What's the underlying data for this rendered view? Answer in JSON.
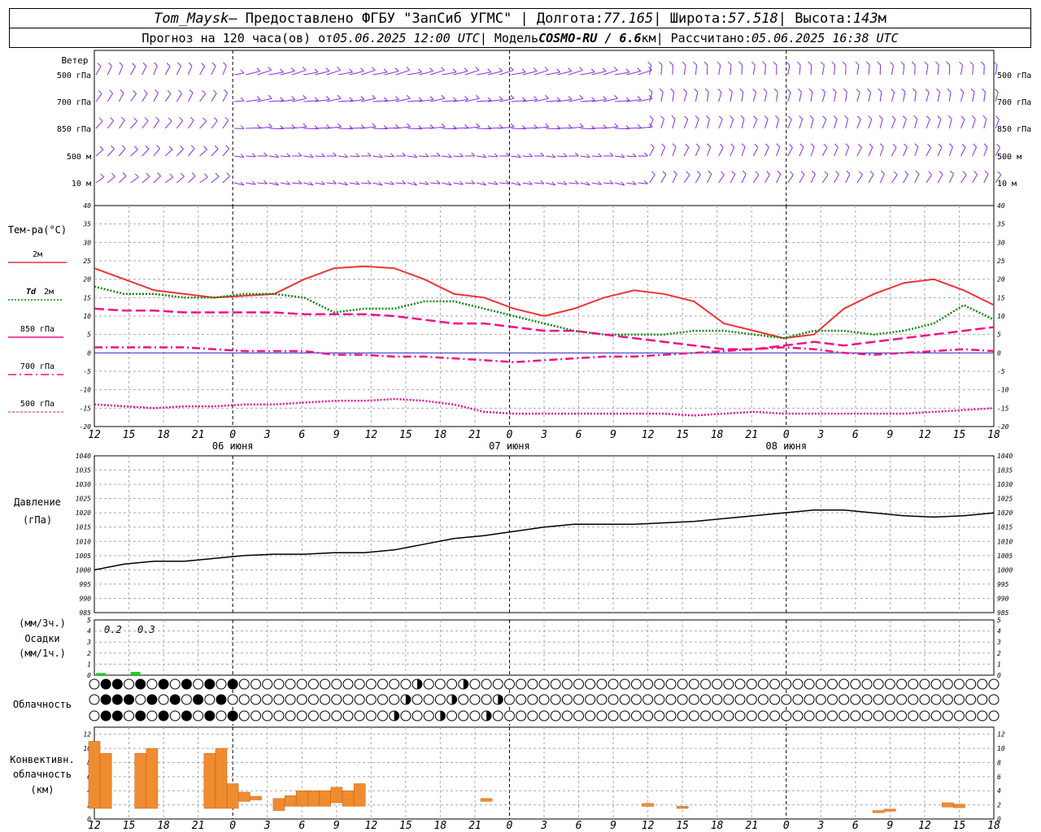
{
  "header": {
    "line1": {
      "station": "Tom_Maysk",
      "provider": " – Предоставлено ФГБУ \"ЗапСиб УГМС\" | Долгота: ",
      "lon": "77.165",
      "lat_label": " | Широта: ",
      "lat": "57.518",
      "alt_label": " | Высота: ",
      "alt": "143",
      "alt_unit": "м"
    },
    "line2": {
      "prefix": "Прогноз на 120 часа(ов) от ",
      "issued": "05.06.2025 12:00 UTC",
      "model_label": " | Модель ",
      "model": "COSMO-RU / 6.6",
      "model_unit": "км",
      "calc_label": " | Рассчитано: ",
      "calc": "05.06.2025 16:38 UTC"
    }
  },
  "colors": {
    "wind": "#8a2be2",
    "t2m": "#ee3333",
    "td2m": "#118811",
    "t850": "#ee1188",
    "t700": "#ee1188",
    "t500": "#ee1188",
    "pressure": "#000000",
    "precip": "#22cc22",
    "conv": "#f08c30",
    "zero_line": "#3333cc"
  },
  "wind_panel": {
    "title": "Ветер",
    "levels": [
      "500 гПа",
      "700 гПа",
      "850 гПа",
      "500 м",
      "10 м"
    ]
  },
  "temp_panel": {
    "title": "Тем-ра(°С)",
    "legend": [
      {
        "label": "2м",
        "style": "solid"
      },
      {
        "label_it": "Td",
        "label": "2м",
        "style": "dot"
      },
      {
        "label": "850 гПа",
        "style": "dash"
      },
      {
        "label": "700 гПа",
        "style": "dashdot"
      },
      {
        "label": "500 гПа",
        "style": "fine"
      }
    ]
  },
  "pressure_panel": {
    "title": "Давление",
    "unit": "(гПа)"
  },
  "precip_panel": {
    "label1": "(мм/3ч.)",
    "label2": "Осадки",
    "label3": "(мм/1ч.)",
    "values_text": [
      "0.2",
      "0.3"
    ]
  },
  "cloud_panel": {
    "title": "Облачность"
  },
  "conv_panel": {
    "label1": "Конвективн.",
    "label2": "облачность",
    "label3": "(км)"
  },
  "x_axis": {
    "hour_labels": [
      "12",
      "15",
      "18",
      "21",
      "0",
      "3",
      "6",
      "9",
      "12",
      "15",
      "18",
      "21",
      "0",
      "3",
      "6",
      "9",
      "12",
      "15",
      "18",
      "21",
      "0",
      "3",
      "6",
      "9",
      "12",
      "15",
      "18"
    ],
    "day_labels": [
      "06 июня",
      "07 июня",
      "08 июня"
    ]
  },
  "chart_data": [
    {
      "type": "line",
      "title": "Тем-ра(°С)",
      "x_hours": [
        0,
        3,
        6,
        9,
        12,
        15,
        18,
        21,
        24,
        27,
        30,
        33,
        36,
        39,
        42,
        45,
        48,
        51,
        54,
        57,
        60,
        63,
        66,
        69,
        72,
        75,
        78
      ],
      "ylim": [
        -20,
        40
      ],
      "series": [
        {
          "name": "2м",
          "values": [
            23,
            20,
            17,
            16,
            15,
            15.5,
            16,
            20,
            23,
            23.5,
            23,
            20,
            16,
            15,
            12,
            10,
            12,
            15,
            17,
            16,
            14,
            8,
            6,
            4,
            5,
            12,
            16,
            19,
            20,
            17,
            13
          ]
        },
        {
          "name": "Td 2м",
          "values": [
            18,
            16,
            16,
            15,
            15,
            16,
            16,
            15,
            11,
            12,
            12,
            14,
            14,
            12,
            10,
            8,
            6,
            5,
            5,
            5,
            6,
            6,
            5,
            4,
            6,
            6,
            5,
            6,
            8,
            13,
            9
          ]
        },
        {
          "name": "850 гПа",
          "values": [
            12,
            11.5,
            11.5,
            11,
            11,
            11,
            11,
            10.5,
            10.5,
            10.5,
            10,
            9,
            8,
            8,
            7,
            6,
            6,
            5,
            4,
            3,
            2,
            1,
            1,
            2,
            3,
            2,
            3,
            4,
            5,
            6,
            7
          ]
        },
        {
          "name": "700 гПа",
          "values": [
            1.5,
            1.5,
            1.5,
            1.5,
            1,
            0.5,
            0.5,
            0.5,
            -0.5,
            -0.5,
            -1,
            -1,
            -1.5,
            -2,
            -2.5,
            -2,
            -1.5,
            -1,
            -1,
            -0.5,
            0,
            0.5,
            1,
            1.5,
            1,
            0,
            -0.5,
            0,
            0.5,
            1,
            0.5
          ]
        },
        {
          "name": "500 гПа",
          "values": [
            -14,
            -14.5,
            -15,
            -14.5,
            -14.5,
            -14,
            -14,
            -13.5,
            -13,
            -13,
            -12.5,
            -13,
            -14,
            -16,
            -16.5,
            -16.5,
            -16.5,
            -16.5,
            -16.5,
            -16.5,
            -17,
            -16.5,
            -16,
            -16.5,
            -16.5,
            -16.5,
            -16.5,
            -16.5,
            -16,
            -15.5,
            -15
          ]
        }
      ]
    },
    {
      "type": "line",
      "title": "Давление",
      "ylabel": "(гПа)",
      "ylim": [
        985,
        1040
      ],
      "series": [
        {
          "name": "Давление",
          "values": [
            1000,
            1002,
            1003,
            1003,
            1004,
            1005,
            1005.5,
            1005.5,
            1006,
            1006,
            1007,
            1009,
            1011,
            1012,
            1013.5,
            1015,
            1016,
            1016,
            1016,
            1016.5,
            1017,
            1018,
            1019,
            1020,
            1021,
            1021,
            1020,
            1019,
            1018.5,
            1019,
            1020
          ]
        }
      ]
    },
    {
      "type": "bar",
      "title": "Осадки",
      "ylabel": "(мм/3ч.)",
      "ylim": [
        0,
        5
      ],
      "series": [
        {
          "name": "Осадки",
          "values": [
            0.2,
            0.3
          ]
        }
      ]
    },
    {
      "type": "bar",
      "title": "Конвективн. облачность",
      "ylabel": "(км)",
      "ylim": [
        0,
        13
      ],
      "segments": [
        {
          "h": 0,
          "base": 1.5,
          "top": 11
        },
        {
          "h": 1,
          "base": 1.5,
          "top": 9.3
        },
        {
          "h": 4,
          "base": 1.5,
          "top": 9.3
        },
        {
          "h": 5,
          "base": 1.5,
          "top": 10
        },
        {
          "h": 10,
          "base": 1.5,
          "top": 9.3
        },
        {
          "h": 11,
          "base": 1.5,
          "top": 10
        },
        {
          "h": 12,
          "base": 1.5,
          "top": 5
        },
        {
          "h": 13,
          "base": 2.5,
          "top": 3.8
        },
        {
          "h": 14,
          "base": 2.7,
          "top": 3.2
        },
        {
          "h": 16,
          "base": 1.2,
          "top": 2.9
        },
        {
          "h": 17,
          "base": 1.8,
          "top": 3.3
        },
        {
          "h": 18,
          "base": 1.8,
          "top": 4
        },
        {
          "h": 19,
          "base": 1.8,
          "top": 4
        },
        {
          "h": 20,
          "base": 1.8,
          "top": 4
        },
        {
          "h": 21,
          "base": 2.3,
          "top": 4.5
        },
        {
          "h": 22,
          "base": 1.8,
          "top": 4
        },
        {
          "h": 23,
          "base": 1.8,
          "top": 5
        },
        {
          "h": 34,
          "base": 2.5,
          "top": 2.9
        },
        {
          "h": 48,
          "base": 1.8,
          "top": 2.2
        },
        {
          "h": 51,
          "base": 1.5,
          "top": 1.8
        },
        {
          "h": 68,
          "base": 0.9,
          "top": 1.2
        },
        {
          "h": 69,
          "base": 1.1,
          "top": 1.4
        },
        {
          "h": 74,
          "base": 1.7,
          "top": 2.3
        },
        {
          "h": 75,
          "base": 1.6,
          "top": 2.1
        }
      ]
    }
  ]
}
